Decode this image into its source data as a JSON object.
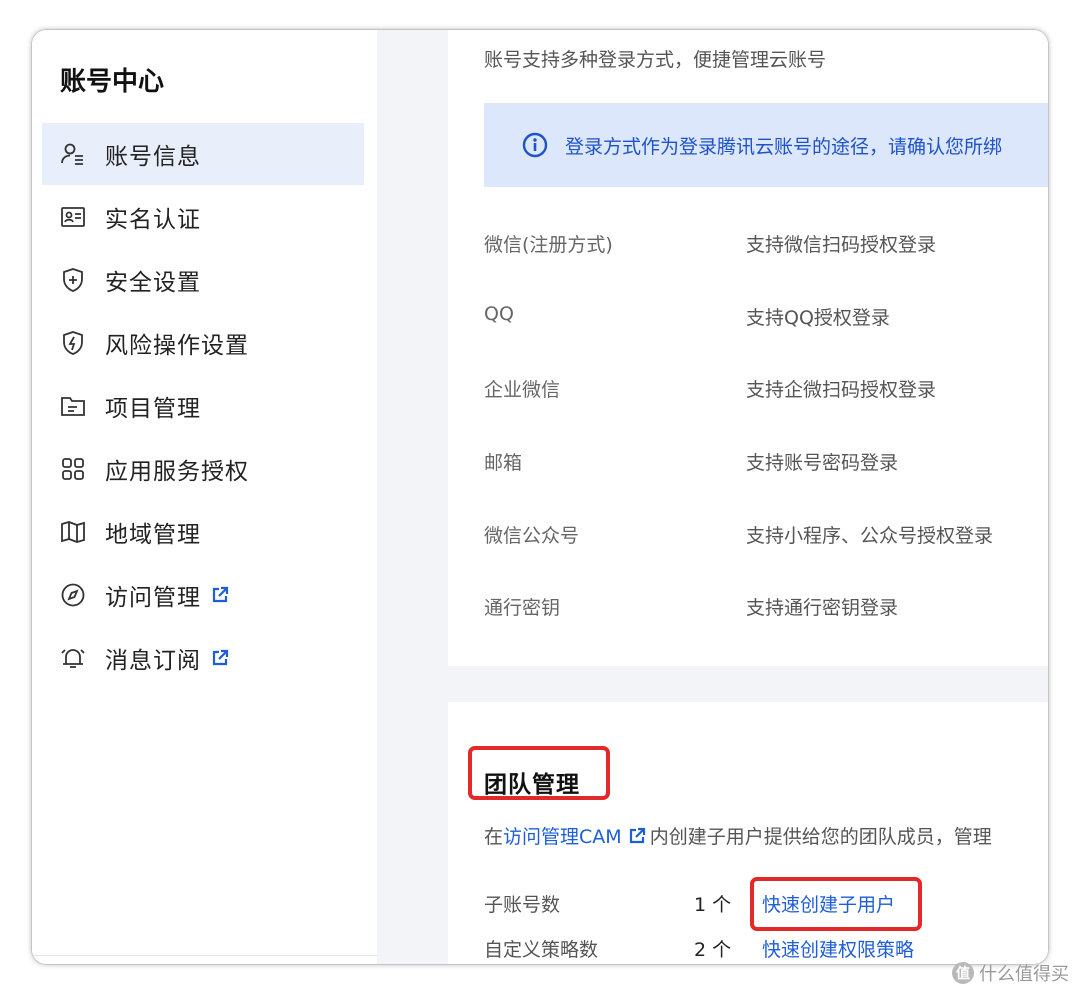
{
  "sidebar": {
    "title": "账号中心",
    "items": [
      {
        "label": "账号信息",
        "icon": "user-icon",
        "active": true
      },
      {
        "label": "实名认证",
        "icon": "id-card-icon"
      },
      {
        "label": "安全设置",
        "icon": "shield-plus-icon"
      },
      {
        "label": "风险操作设置",
        "icon": "shield-bolt-icon"
      },
      {
        "label": "项目管理",
        "icon": "folder-icon"
      },
      {
        "label": "应用服务授权",
        "icon": "apps-grid-icon"
      },
      {
        "label": "地域管理",
        "icon": "map-icon"
      },
      {
        "label": "访问管理",
        "icon": "compass-icon",
        "external": true
      },
      {
        "label": "消息订阅",
        "icon": "bell-icon",
        "external": true
      }
    ]
  },
  "login": {
    "subtitle": "账号支持多种登录方式，便捷管理云账号",
    "notice": "登录方式作为登录腾讯云账号的途径，请确认您所绑",
    "methods": [
      {
        "name": "微信(注册方式)",
        "desc": "支持微信扫码授权登录"
      },
      {
        "name": "QQ",
        "desc": "支持QQ授权登录"
      },
      {
        "name": "企业微信",
        "desc": "支持企微扫码授权登录"
      },
      {
        "name": "邮箱",
        "desc": "支持账号密码登录"
      },
      {
        "name": "微信公众号",
        "desc": "支持小程序、公众号授权登录"
      },
      {
        "name": "通行密钥",
        "desc": "支持通行密钥登录"
      }
    ]
  },
  "team": {
    "title": "团队管理",
    "desc_prefix": "在",
    "desc_link": "访问管理CAM",
    "desc_suffix": "内创建子用户提供给您的团队成员，管理",
    "stats": [
      {
        "label": "子账号数",
        "count": "1 个",
        "action": "快速创建子用户"
      },
      {
        "label": "自定义策略数",
        "count": "2 个",
        "action": "快速创建权限策略"
      }
    ]
  },
  "watermark": {
    "badge": "值",
    "text": "什么值得买"
  },
  "colors": {
    "accent": "#1e5ed6",
    "highlight": "#e4292b",
    "active_bg": "#e9eefb",
    "notice_bg": "#dde7fb"
  }
}
